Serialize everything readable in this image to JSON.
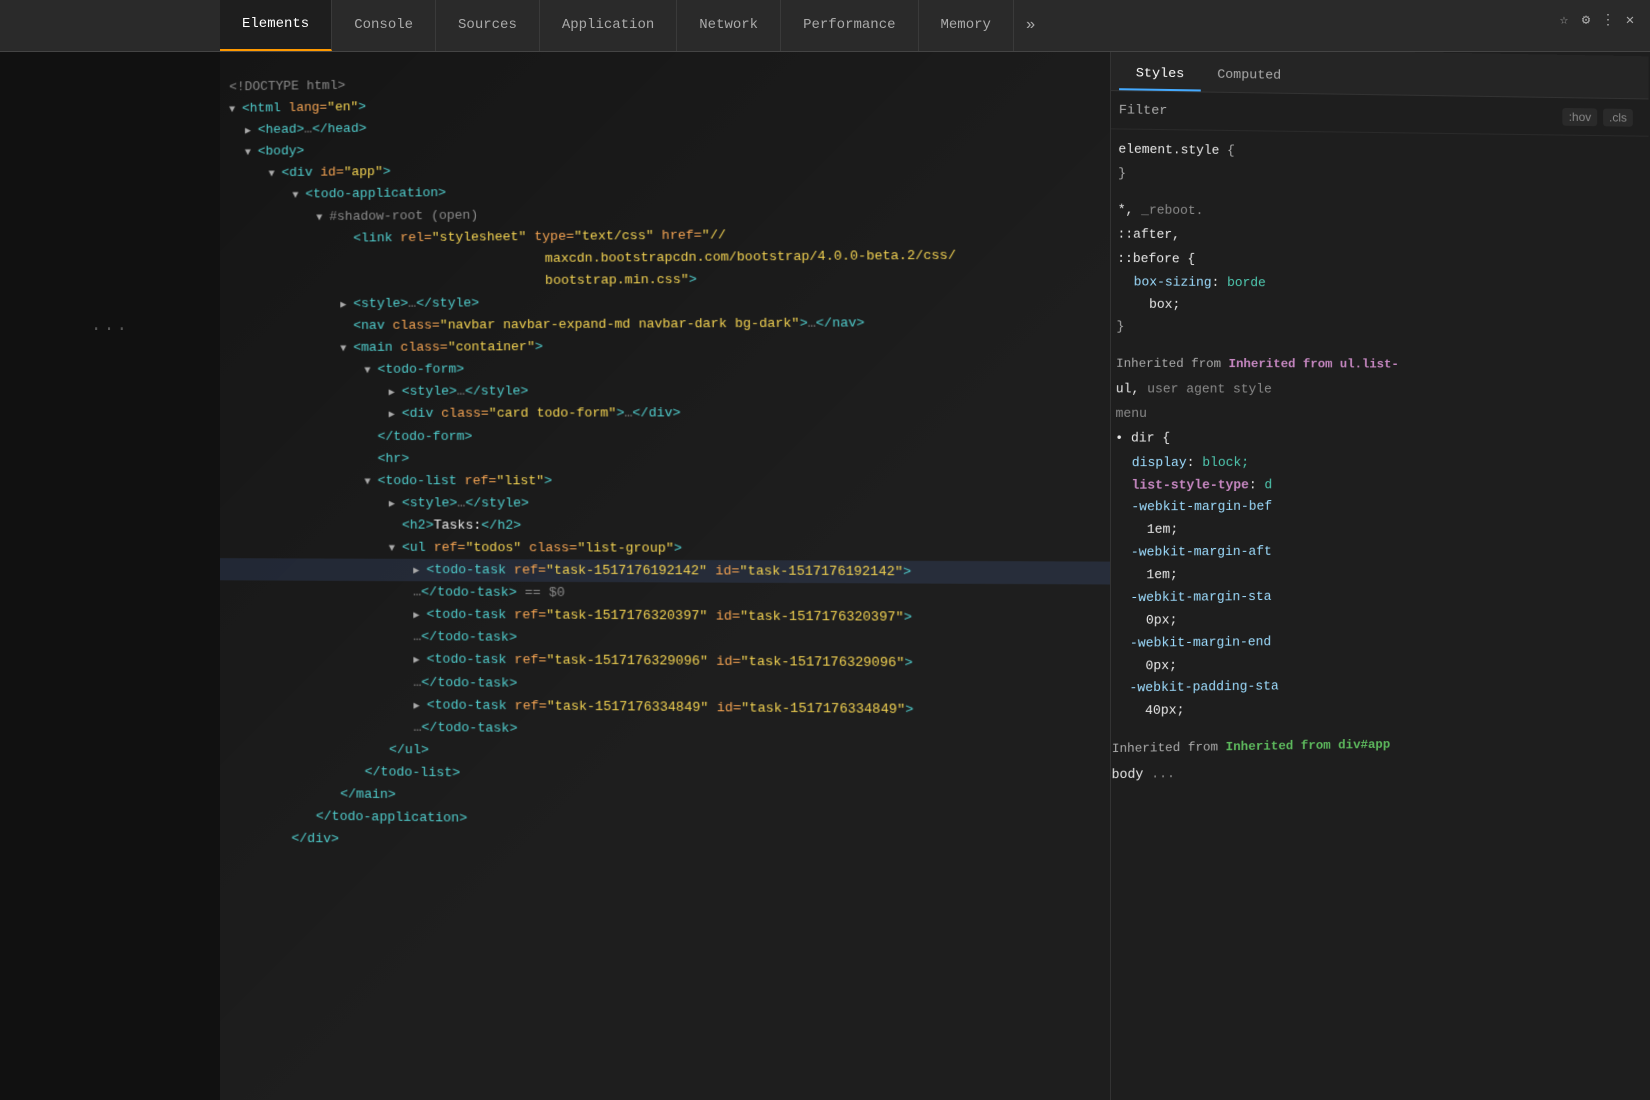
{
  "tabs": {
    "items": [
      {
        "label": "Elements",
        "active": true
      },
      {
        "label": "Console",
        "active": false
      },
      {
        "label": "Sources",
        "active": false
      },
      {
        "label": "Application",
        "active": false
      },
      {
        "label": "Network",
        "active": false
      },
      {
        "label": "Performance",
        "active": false
      },
      {
        "label": "Memory",
        "active": false
      }
    ],
    "more_label": "»"
  },
  "styles_tabs": [
    {
      "label": "Styles",
      "active": true
    },
    {
      "label": "Computed",
      "active": false
    }
  ],
  "filter": {
    "label": "Filter",
    "hov_label": ":hov",
    "cls_label": ".cls"
  },
  "dom": {
    "lines": [
      "<!DOCTYPE html>",
      "<html lang=\"en\">",
      "  ▶<head>…</head>",
      "  ▼<body>",
      "    ▼<div id=\"app\">",
      "      ▼<todo-application>",
      "        ▼#shadow-root (open)",
      "          <link rel=\"stylesheet\" type=\"text/css\" href=\"//",
      "          maxcdn.bootstrapcdn.com/bootstrap/4.0.0-beta.2/css/",
      "          bootstrap.min.css\">",
      "          ▶<style>…</style>",
      "          <nav class=\"navbar navbar-expand-md navbar-dark bg-dark\">…</nav>",
      "          ▼<main class=\"container\">",
      "            ▼<todo-form>",
      "              ▶<style>…</style>",
      "              ▶<div class=\"card todo-form\">…</div>",
      "            </todo-form>",
      "            <hr>",
      "            ▼<todo-list ref=\"list\">",
      "              ▶<style>…</style>",
      "              <h2>Tasks:</h2>",
      "              ▼<ul ref=\"todos\" class=\"list-group\">",
      "                ▶<todo-task ref=\"task-1517176192142\" id=\"task-1517176192142\">",
      "                …</todo-task> == $0",
      "                ▶<todo-task ref=\"task-1517176320397\" id=\"task-1517176320397\">",
      "                …</todo-task>",
      "                ▶<todo-task ref=\"task-1517176329096\" id=\"task-1517176329096\">",
      "                …</todo-task>",
      "                ▶<todo-task ref=\"task-1517176334849\" id=\"task-1517176334849\">",
      "                …</todo-task>",
      "              </ul>",
      "            </todo-list>",
      "          </main>",
      "        </todo-application>",
      "        </div>"
    ]
  },
  "styles": {
    "element_style": {
      "selector": "element.style {",
      "close": "}"
    },
    "wildcard": {
      "selector": "*,",
      "selector2": "::after,",
      "selector3": "::before {",
      "prop": "box-sizing:",
      "val": "borde",
      "val2": "box;",
      "close": "}"
    },
    "inherited_ul": "Inherited from ul.list-",
    "ul_agent": "ul, user agent style",
    "menu_rule": {
      "selector": "dir {",
      "props": [
        {
          "name": "display:",
          "val": "block;"
        },
        {
          "name": "list-style-type:",
          "val": "d",
          "highlighted": true
        },
        {
          "name": "-webkit-margin-bef",
          "val": "1em;"
        },
        {
          "name": "-webkit-margin-aft",
          "val": "1em;"
        },
        {
          "name": "-webkit-margin-sta",
          "val": "0px;"
        },
        {
          "name": "-webkit-margin-end",
          "val": "0px;"
        },
        {
          "name": "-webkit-padding-sta",
          "val": "40px;"
        }
      ]
    },
    "inherited_div": "Inherited from div#app"
  },
  "sidebar_dots": "..."
}
